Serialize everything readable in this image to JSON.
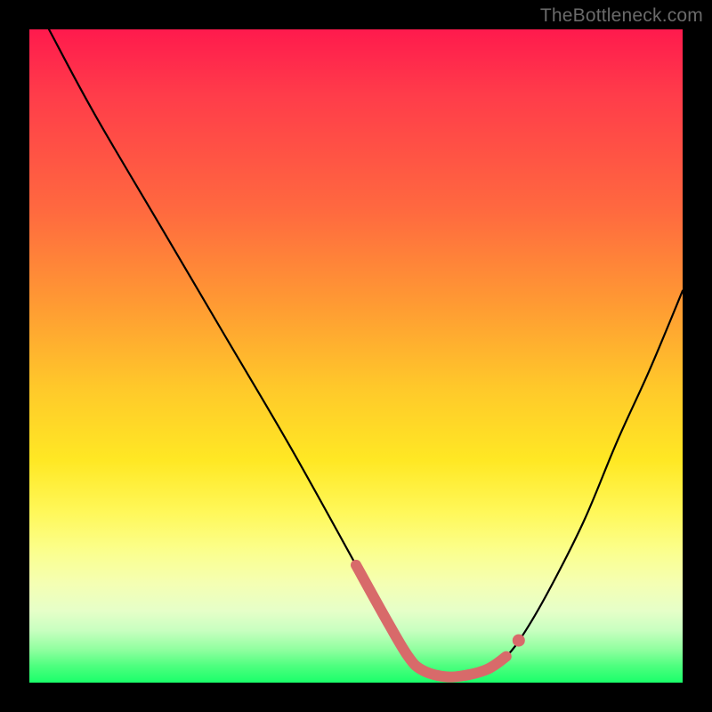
{
  "watermark": "TheBottleneck.com",
  "colors": {
    "frame": "#000000",
    "gradient_top": "#ff1a4d",
    "gradient_mid": "#ffe824",
    "gradient_bottom": "#1aff6a",
    "curve": "#000000",
    "highlight": "#d86a6a"
  },
  "chart_data": {
    "type": "line",
    "title": "",
    "xlabel": "",
    "ylabel": "",
    "xlim": [
      0,
      100
    ],
    "ylim": [
      0,
      100
    ],
    "series": [
      {
        "name": "bottleneck-curve",
        "x": [
          3,
          10,
          20,
          30,
          40,
          50,
          55,
          58,
          60,
          63,
          66,
          70,
          73,
          76,
          80,
          85,
          90,
          95,
          100
        ],
        "values": [
          100,
          87,
          70,
          53,
          36,
          18,
          9,
          4,
          2,
          1,
          1,
          2,
          4,
          8,
          15,
          25,
          37,
          48,
          60
        ]
      }
    ],
    "highlight_segment": {
      "x_start": 55,
      "x_end": 73,
      "note": "thick salmon segment at curve minimum"
    }
  }
}
